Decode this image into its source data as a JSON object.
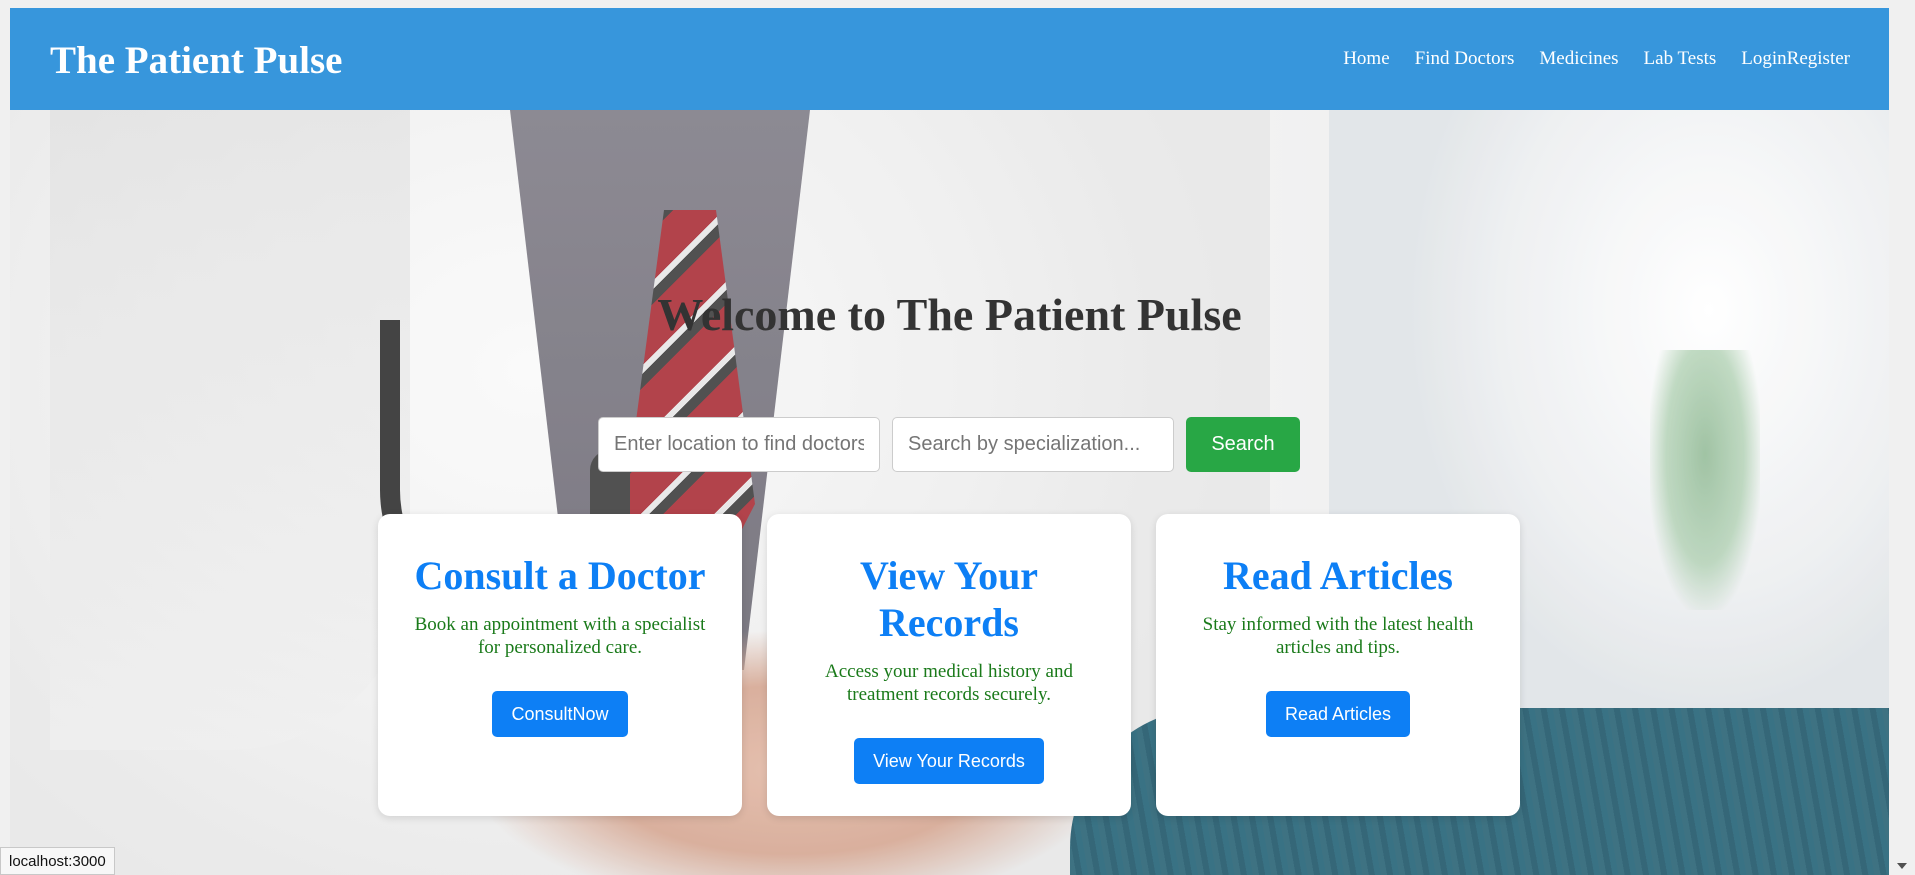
{
  "header": {
    "brand": "The Patient Pulse",
    "nav": {
      "home": "Home",
      "find_doctors": "Find Doctors",
      "medicines": "Medicines",
      "lab_tests": "Lab Tests",
      "login": "Login",
      "register": "Register"
    }
  },
  "hero": {
    "title": "Welcome to The Patient Pulse"
  },
  "search": {
    "location_placeholder": "Enter location to find doctors",
    "specialization_placeholder": "Search by specialization...",
    "button_label": "Search"
  },
  "cards": [
    {
      "title": "Consult a Doctor",
      "text": "Book an appointment with a specialist for personalized care.",
      "button": "ConsultNow"
    },
    {
      "title": "View Your Records",
      "text": "Access your medical history and treatment records securely.",
      "button": "View Your Records"
    },
    {
      "title": "Read Articles",
      "text": "Stay informed with the latest health articles and tips.",
      "button": "Read Articles"
    }
  ],
  "status_bar": {
    "url": "localhost:3000"
  },
  "colors": {
    "header": "#3796dc",
    "search_button": "#28a745",
    "card_accent": "#0d7ff5",
    "card_text": "#1a7a1a"
  }
}
